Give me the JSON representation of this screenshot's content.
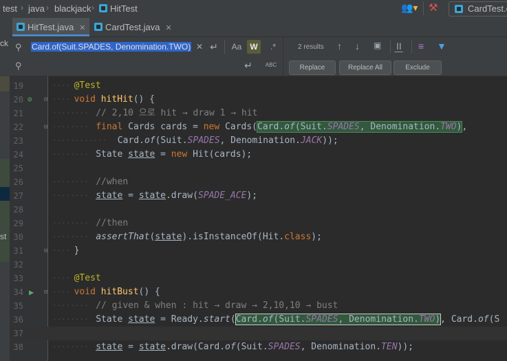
{
  "breadcrumb": [
    "test",
    "java",
    "blackjack",
    "HitTest"
  ],
  "nav_right_tab": "CardTest.ot",
  "tabs": [
    {
      "label": "HitTest.java",
      "active": true
    },
    {
      "label": "CardTest.java",
      "active": false
    }
  ],
  "find": {
    "query": "Card.of(Suit.SPADES, Denomination.TWO)",
    "results": "2 results",
    "buttons": {
      "replace": "Replace",
      "replace_all": "Replace All",
      "exclude": "Exclude"
    },
    "case_label": "Aa",
    "word_label": "W",
    "regex_label": ".*",
    "abc_label": "ABC"
  },
  "lines": [
    {
      "n": "19",
      "indent": "····",
      "html": "<span class=\"ann\">@Test</span>"
    },
    {
      "n": "20",
      "indent": "····",
      "html": "<span class=\"k\">void</span> <span class=\"fn\">hitHit</span>() {"
    },
    {
      "n": "21",
      "indent": "········",
      "html": "<span class=\"cm\">// 2,10 으로 hit → draw 1 → hit</span>"
    },
    {
      "n": "22",
      "indent": "········",
      "html": "<span class=\"k\">final</span> Cards cards = <span class=\"k\">new</span> Cards(<span class=\"hl\">Card.<span class=\"it\">of</span>(Suit.<span class=\"st\">SPADES</span>, Denomination.<span class=\"st\">TWO</span>)</span>,"
    },
    {
      "n": "23",
      "indent": "············",
      "html": "Card.<span class=\"it\">of</span>(Suit.<span class=\"st\">SPADES</span>, Denomination.<span class=\"st\">JACK</span>));"
    },
    {
      "n": "24",
      "indent": "········",
      "html": "State <span class=\"ul\">state</span> = <span class=\"k\">new</span> Hit(cards);"
    },
    {
      "n": "25",
      "indent": "",
      "html": ""
    },
    {
      "n": "26",
      "indent": "········",
      "html": "<span class=\"cm\">//when</span>"
    },
    {
      "n": "27",
      "indent": "········",
      "html": "<span class=\"ul\">state</span> = <span class=\"ul\">state</span>.draw(<span class=\"st\">SPADE_ACE</span>);"
    },
    {
      "n": "28",
      "indent": "",
      "html": ""
    },
    {
      "n": "29",
      "indent": "········",
      "html": "<span class=\"cm\">//then</span>"
    },
    {
      "n": "30",
      "indent": "········",
      "html": "<span class=\"it\">assertThat</span>(<span class=\"ul\">state</span>).isInstanceOf(Hit.<span class=\"k\">class</span>);"
    },
    {
      "n": "31",
      "indent": "····",
      "html": "}"
    },
    {
      "n": "32",
      "indent": "",
      "html": ""
    },
    {
      "n": "33",
      "indent": "····",
      "html": "<span class=\"ann\">@Test</span>"
    },
    {
      "n": "34",
      "indent": "····",
      "html": "<span class=\"k\">void</span> <span class=\"fn\">hitBust</span>() {"
    },
    {
      "n": "35",
      "indent": "········",
      "html": "<span class=\"cm\">// given &amp; when : hit → draw → 2,10,10 → bust</span>"
    },
    {
      "n": "36",
      "indent": "········",
      "html": "State <span class=\"ul\">state</span> = Ready.<span class=\"it\">start</span>(<span class=\"hlc\">Card.<span class=\"it\">of</span>(Suit.<span class=\"st\">SPADES</span>, Denomination.<span class=\"st\">TWO</span>)</span>, Card.<span class=\"it\">of</span>(S"
    },
    {
      "n": "37",
      "indent": "",
      "html": ""
    },
    {
      "n": "38",
      "indent": "········",
      "html": "<span class=\"ul\">state</span> = <span class=\"ul\">state</span>.draw(Card.<span class=\"it\">of</span>(Suit.<span class=\"st\">SPADES</span>, Denomination.<span class=\"st\">TEN</span>));"
    }
  ]
}
